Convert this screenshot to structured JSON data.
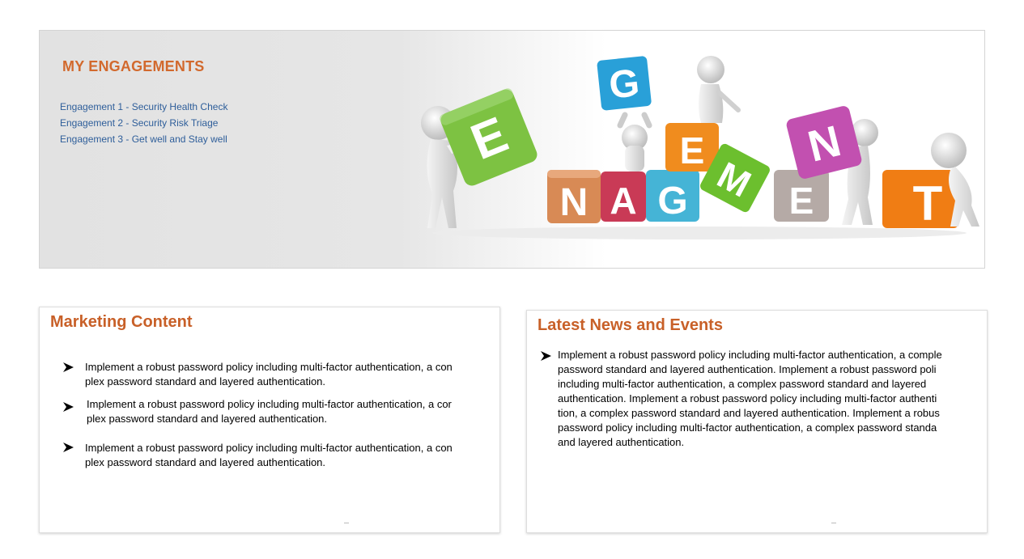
{
  "banner": {
    "title": "MY ENGAGEMENTS",
    "engagements": [
      "Engagement 1 - Security Health Check",
      "Engagement 2 - Security Risk Triage",
      "Engagement 3 - Get well and Stay well"
    ],
    "art_letters": [
      "E",
      "G",
      "E",
      "N",
      "N",
      "A",
      "G",
      "M",
      "E",
      "T"
    ]
  },
  "marketing": {
    "title": "Marketing Content",
    "items": [
      {
        "line1": "Implement a robust password policy including multi-factor authentication, a con",
        "line2": "plex password standard and layered authentication."
      },
      {
        "line1": "Implement a robust password policy including multi-factor authentication, a cor",
        "line2": "plex password standard and layered authentication."
      },
      {
        "line1": "Implement a robust password policy including multi-factor authentication, a con",
        "line2": "plex password standard and layered authentication."
      }
    ]
  },
  "news": {
    "title": "Latest News and Events",
    "lines": [
      "Implement a robust password policy including multi-factor authentication, a comple",
      "password standard and layered authentication.  Implement a robust password poli",
      "including multi-factor authentication, a complex password standard and layered",
      "authentication. Implement a robust password policy including multi-factor authenti",
      "tion, a complex password standard and layered authentication. Implement a robus",
      "password policy including multi-factor authentication, a complex password standa",
      "and layered authentication."
    ]
  },
  "colors": {
    "accent": "#d2692d",
    "link": "#2e5e9a"
  }
}
